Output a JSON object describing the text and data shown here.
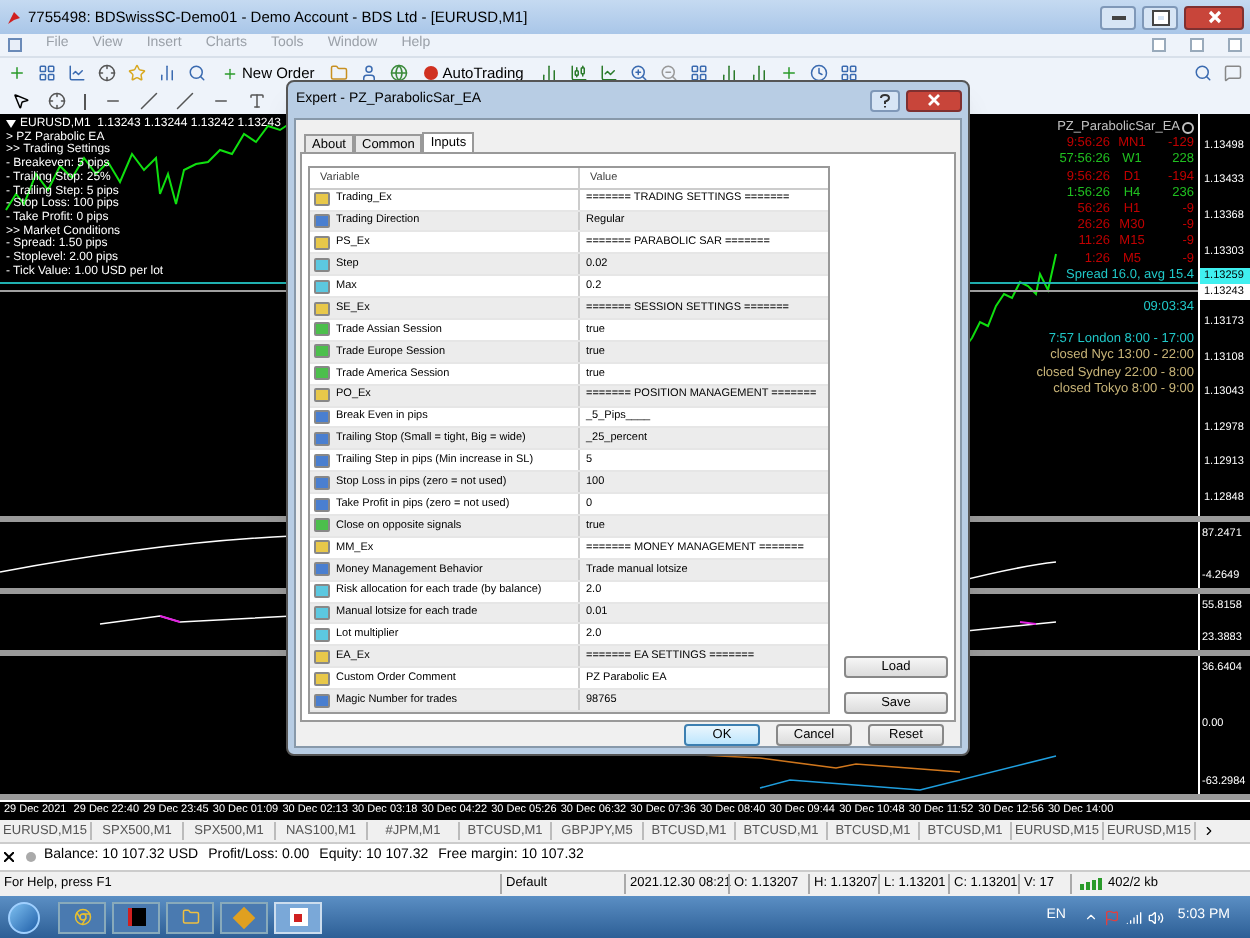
{
  "window": {
    "title": "7755498: BDSwissSC-Demo01 - Demo Account - BDS Ltd - [EURUSD,M1]"
  },
  "menu": {
    "disabled": true,
    "items": [
      "File",
      "View",
      "Insert",
      "Charts",
      "Tools",
      "Window",
      "Help"
    ]
  },
  "toolbar": {
    "buttons": [
      "New Order",
      "AutoTrading"
    ]
  },
  "chart": {
    "header": "EURUSD,M1  1.13243 1.13244 1.13242 1.13243",
    "info_lines": [
      "> PZ Parabolic EA",
      ">> Trading Settings",
      "- Breakeven: 5 pips",
      "- Trailing Stop: 25%",
      "- Trailing Step: 5 pips",
      "- Stop Loss: 100 pips",
      "- Take Profit: 0 pips",
      ">> Market Conditions",
      "- Spread: 1.50 pips",
      "- Stoplevel: 2.00 pips",
      "- Tick Value: 1.00 USD per lot"
    ],
    "ea_name": "PZ_ParabolicSar_EA",
    "timeframes": [
      {
        "time": "9:56:26",
        "tf": "MN1",
        "value": "-129",
        "color": "#c00000"
      },
      {
        "time": "57:56:26",
        "tf": "W1",
        "value": "228",
        "color": "#20c020"
      },
      {
        "time": "9:56:26",
        "tf": "D1",
        "value": "-194",
        "color": "#c00000"
      },
      {
        "time": "1:56:26",
        "tf": "H4",
        "value": "236",
        "color": "#20c020"
      },
      {
        "time": "56:26",
        "tf": "H1",
        "value": "-9",
        "color": "#c00000"
      },
      {
        "time": "26:26",
        "tf": "M30",
        "value": "-9",
        "color": "#c00000"
      },
      {
        "time": "11:26",
        "tf": "M15",
        "value": "-9",
        "color": "#c00000"
      },
      {
        "time": "1:26",
        "tf": "M5",
        "value": "-9",
        "color": "#c00000"
      }
    ],
    "spread": "Spread 16.0, avg 15.4",
    "clock": "09:03:34",
    "sessions": [
      {
        "text": "7:57 London 8:00 - 17:00",
        "color": "#20c8c8"
      },
      {
        "text": "closed Nyc 13:00 - 22:00",
        "color": "#c8b478"
      },
      {
        "text": "closed Sydney 22:00 - 8:00",
        "color": "#c8b478"
      },
      {
        "text": "closed Tokyo 8:00 - 9:00",
        "color": "#c8b478"
      }
    ],
    "price_ticks_upper": [
      "1.13498",
      "1.13433",
      "1.13368",
      "1.13303"
    ],
    "ask_price": "1.13259",
    "bid_price": "1.13243",
    "price_ticks_lower": [
      "1.13173",
      "1.13108",
      "1.13043",
      "1.12978",
      "1.12913",
      "1.12848"
    ],
    "indicator_axes": [
      [
        "87.2471",
        "-4.2649"
      ],
      [
        "55.8158",
        "23.3883"
      ],
      [
        "36.6404",
        "0.00",
        "-63.2984"
      ]
    ],
    "time_axis": [
      "29 Dec 2021",
      "29 Dec 22:40",
      "29 Dec 23:45",
      "30 Dec 01:09",
      "30 Dec 02:13",
      "30 Dec 03:18",
      "30 Dec 04:22",
      "30 Dec 05:26",
      "30 Dec 06:32",
      "30 Dec 07:36",
      "30 Dec 08:40",
      "30 Dec 09:44",
      "30 Dec 10:48",
      "30 Dec 11:52",
      "30 Dec 12:56",
      "30 Dec 14:00"
    ]
  },
  "dialog": {
    "title": "Expert - PZ_ParabolicSar_EA",
    "tabs": [
      {
        "label": "About",
        "selected": false
      },
      {
        "label": "Common",
        "selected": false
      },
      {
        "label": "Inputs",
        "selected": true
      }
    ],
    "columns": [
      "Variable",
      "Value"
    ],
    "rows": [
      {
        "kind": "string",
        "variable": "Trading_Ex",
        "value": "======= TRADING SETTINGS ======="
      },
      {
        "kind": "int",
        "variable": "Trading Direction",
        "value": "Regular"
      },
      {
        "kind": "string",
        "variable": "PS_Ex",
        "value": "======= PARABOLIC SAR ======="
      },
      {
        "kind": "double",
        "variable": "Step",
        "value": "0.02"
      },
      {
        "kind": "double",
        "variable": "Max",
        "value": "0.2"
      },
      {
        "kind": "string",
        "variable": "SE_Ex",
        "value": "======= SESSION SETTINGS ======="
      },
      {
        "kind": "bool",
        "variable": "Trade Assian Session",
        "value": "true"
      },
      {
        "kind": "bool",
        "variable": "Trade Europe Session",
        "value": "true"
      },
      {
        "kind": "bool",
        "variable": "Trade America Session",
        "value": "true"
      },
      {
        "kind": "string",
        "variable": "PO_Ex",
        "value": "======= POSITION MANAGEMENT ======="
      },
      {
        "kind": "int",
        "variable": "Break Even in pips",
        "value": "_5_Pips____"
      },
      {
        "kind": "int",
        "variable": "Trailing Stop (Small = tight, Big = wide)",
        "value": "_25_percent"
      },
      {
        "kind": "int",
        "variable": "Trailing Step in pips (Min increase in SL)",
        "value": "5"
      },
      {
        "kind": "int",
        "variable": "Stop Loss in pips (zero = not used)",
        "value": "100"
      },
      {
        "kind": "int",
        "variable": "Take Profit in pips (zero = not used)",
        "value": "0"
      },
      {
        "kind": "bool",
        "variable": "Close on opposite signals",
        "value": "true"
      },
      {
        "kind": "string",
        "variable": "MM_Ex",
        "value": "======= MONEY MANAGEMENT ======="
      },
      {
        "kind": "int",
        "variable": "Money Management Behavior",
        "value": "Trade manual lotsize"
      },
      {
        "kind": "double",
        "variable": "Risk allocation for each trade (by balance)",
        "value": "2.0"
      },
      {
        "kind": "double",
        "variable": "Manual lotsize for each trade",
        "value": "0.01"
      },
      {
        "kind": "double",
        "variable": "Lot multiplier",
        "value": "2.0"
      },
      {
        "kind": "string",
        "variable": "EA_Ex",
        "value": "======= EA SETTINGS ======="
      },
      {
        "kind": "string",
        "variable": "Custom Order Comment",
        "value": "PZ Parabolic EA"
      },
      {
        "kind": "int",
        "variable": "Magic Number for trades",
        "value": "98765"
      }
    ],
    "side_buttons": [
      "Load",
      "Save"
    ],
    "buttons": [
      {
        "label": "OK",
        "default": true
      },
      {
        "label": "Cancel",
        "default": false
      },
      {
        "label": "Reset",
        "default": false
      }
    ]
  },
  "symbol_tabs": [
    {
      "label": "EURUSD,M15",
      "selected": false
    },
    {
      "label": "SPX500,M1",
      "selected": false
    },
    {
      "label": "SPX500,M1",
      "selected": false
    },
    {
      "label": "NAS100,M1",
      "selected": false
    },
    {
      "label": "#JPM,M1",
      "selected": false
    },
    {
      "label": "BTCUSD,M1",
      "selected": false
    },
    {
      "label": "GBPJPY,M5",
      "selected": false
    },
    {
      "label": "BTCUSD,M1",
      "selected": false
    },
    {
      "label": "BTCUSD,M1",
      "selected": false
    },
    {
      "label": "BTCUSD,M1",
      "selected": false
    },
    {
      "label": "BTCUSD,M1",
      "selected": false
    },
    {
      "label": "EURUSD,M15",
      "selected": false
    },
    {
      "label": "EURUSD,M15",
      "selected": false
    }
  ],
  "account": [
    "Balance: 10 107.32 USD",
    "Profit/Loss: 0.00",
    "Equity: 10 107.32",
    "Free margin: 10 107.32"
  ],
  "status_bar": {
    "help": "For Help, press F1",
    "cells": [
      "Default",
      "2021.12.30 08:21",
      "O: 1.13207",
      "H: 1.13207",
      "L: 1.13201",
      "C: 1.13201",
      "V: 17"
    ],
    "traffic": "402/2 kb"
  },
  "taskbar": {
    "language": "EN",
    "time": "5:03 PM"
  }
}
